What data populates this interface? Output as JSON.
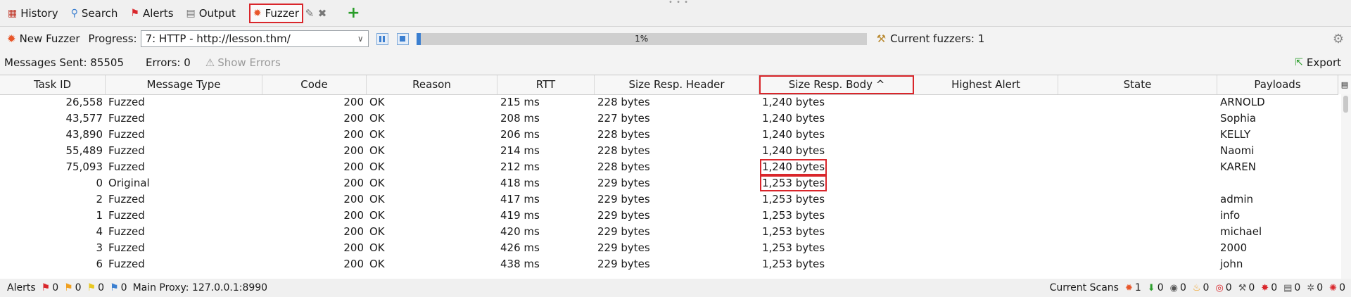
{
  "tabs": [
    {
      "label": "History",
      "icon": "history-icon"
    },
    {
      "label": "Search",
      "icon": "search-icon"
    },
    {
      "label": "Alerts",
      "icon": "alerts-flag-icon"
    },
    {
      "label": "Output",
      "icon": "output-icon"
    },
    {
      "label": "Fuzzer",
      "icon": "fuzzer-icon",
      "active": true
    }
  ],
  "toolbar": {
    "new_fuzzer": "New Fuzzer",
    "progress_label": "Progress:",
    "progress_select": "7: HTTP - http://lesson.thm/",
    "progress_value": 1,
    "progress_text": "1%",
    "current_fuzzers": "Current fuzzers: 1"
  },
  "stats": {
    "messages_sent": "Messages Sent: 85505",
    "errors": "Errors: 0",
    "show_errors": "Show Errors",
    "export": "Export"
  },
  "table": {
    "columns": [
      "Task ID",
      "Message Type",
      "Code",
      "Reason",
      "RTT",
      "Size Resp. Header",
      "Size Resp. Body ^",
      "Highest Alert",
      "State",
      "Payloads"
    ],
    "sorted_column": "Size Resp. Body",
    "rows": [
      {
        "task_id": "26,558",
        "type": "Fuzzed",
        "code": "200",
        "reason": "OK",
        "rtt": "215 ms",
        "header": "228 bytes",
        "body": "1,240 bytes",
        "alert": "",
        "state": "",
        "payload": "ARNOLD"
      },
      {
        "task_id": "43,577",
        "type": "Fuzzed",
        "code": "200",
        "reason": "OK",
        "rtt": "208 ms",
        "header": "227 bytes",
        "body": "1,240 bytes",
        "alert": "",
        "state": "",
        "payload": "Sophia"
      },
      {
        "task_id": "43,890",
        "type": "Fuzzed",
        "code": "200",
        "reason": "OK",
        "rtt": "206 ms",
        "header": "228 bytes",
        "body": "1,240 bytes",
        "alert": "",
        "state": "",
        "payload": "KELLY"
      },
      {
        "task_id": "55,489",
        "type": "Fuzzed",
        "code": "200",
        "reason": "OK",
        "rtt": "214 ms",
        "header": "228 bytes",
        "body": "1,240 bytes",
        "alert": "",
        "state": "",
        "payload": "Naomi"
      },
      {
        "task_id": "75,093",
        "type": "Fuzzed",
        "code": "200",
        "reason": "OK",
        "rtt": "212 ms",
        "header": "228 bytes",
        "body": "1,240 bytes",
        "alert": "",
        "state": "",
        "payload": "KAREN",
        "highlight": true
      },
      {
        "task_id": "0",
        "type": "Original",
        "code": "200",
        "reason": "OK",
        "rtt": "418 ms",
        "header": "229 bytes",
        "body": "1,253 bytes",
        "alert": "",
        "state": "",
        "payload": "",
        "highlight": true
      },
      {
        "task_id": "2",
        "type": "Fuzzed",
        "code": "200",
        "reason": "OK",
        "rtt": "417 ms",
        "header": "229 bytes",
        "body": "1,253 bytes",
        "alert": "",
        "state": "",
        "payload": "admin"
      },
      {
        "task_id": "1",
        "type": "Fuzzed",
        "code": "200",
        "reason": "OK",
        "rtt": "419 ms",
        "header": "229 bytes",
        "body": "1,253 bytes",
        "alert": "",
        "state": "",
        "payload": "info"
      },
      {
        "task_id": "4",
        "type": "Fuzzed",
        "code": "200",
        "reason": "OK",
        "rtt": "420 ms",
        "header": "229 bytes",
        "body": "1,253 bytes",
        "alert": "",
        "state": "",
        "payload": "michael"
      },
      {
        "task_id": "3",
        "type": "Fuzzed",
        "code": "200",
        "reason": "OK",
        "rtt": "426 ms",
        "header": "229 bytes",
        "body": "1,253 bytes",
        "alert": "",
        "state": "",
        "payload": "2000"
      },
      {
        "task_id": "6",
        "type": "Fuzzed",
        "code": "200",
        "reason": "OK",
        "rtt": "438 ms",
        "header": "229 bytes",
        "body": "1,253 bytes",
        "alert": "",
        "state": "",
        "payload": "john"
      }
    ]
  },
  "statusbar": {
    "alerts_label": "Alerts",
    "alert_counts": [
      "0",
      "0",
      "0",
      "0"
    ],
    "main_proxy": "Main Proxy: 127.0.0.1:8990",
    "current_scans": "Current Scans",
    "scan_counts": [
      "1",
      "0",
      "0",
      "0",
      "0",
      "0",
      "0",
      "0",
      "0",
      "0"
    ]
  },
  "colors": {
    "highlight": "#d9262b",
    "progress": "#3b7fd0",
    "add": "#2a9d2a"
  }
}
